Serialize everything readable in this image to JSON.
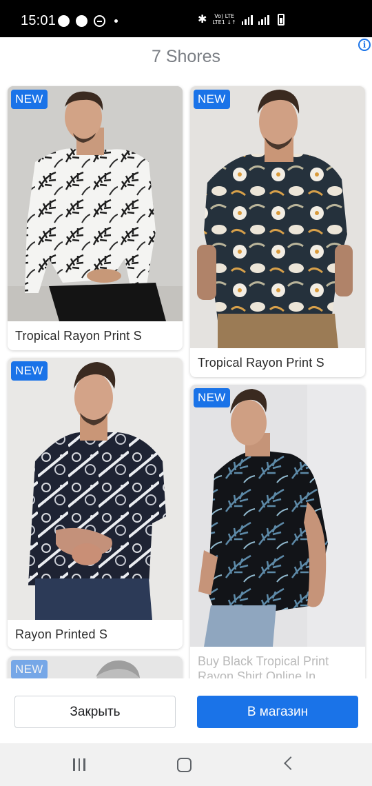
{
  "status_bar": {
    "time": "15:01",
    "lte_top": "Vo) LTE",
    "lte_bottom": "LTE1 ↓↑"
  },
  "header": {
    "title": "7 Shores"
  },
  "products": [
    {
      "badge": "NEW",
      "title": "Tropical Rayon Print S",
      "pattern": "white-black-palm"
    },
    {
      "badge": "NEW",
      "title": "Tropical Rayon Print S",
      "pattern": "navy-white-floral"
    },
    {
      "badge": "NEW",
      "title": "Rayon Printed S",
      "pattern": "navy-paisley"
    },
    {
      "badge": "NEW",
      "title": "Buy Black Tropical Print",
      "title_line2": "Rayon Shirt Online In...",
      "pattern": "black-blue-palm"
    },
    {
      "badge": "NEW",
      "title": "",
      "pattern": "grey-partial"
    }
  ],
  "buttons": {
    "close_label": "Закрыть",
    "shop_label": "В магазин"
  },
  "colors": {
    "accent": "#1a73e8",
    "title_grey": "#7a7e84",
    "status_bar": "#000000",
    "nav_bar": "#f1f1f1"
  }
}
